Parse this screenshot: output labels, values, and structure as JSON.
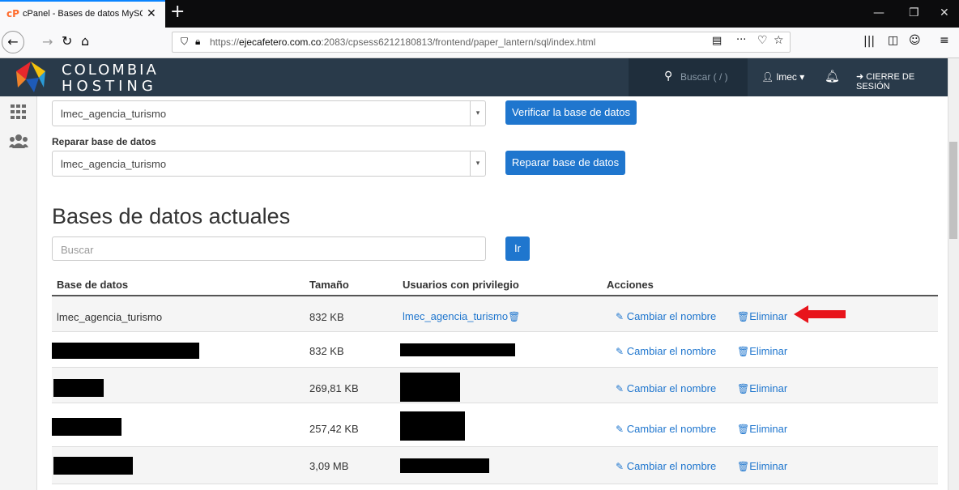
{
  "browser": {
    "tab_title": "cPanel - Bases de datos MySQL",
    "url_prefix": "https://",
    "url_host": "ejecafetero.com.co",
    "url_path": ":2083/cpsess6212180813/frontend/paper_lantern/sql/index.html"
  },
  "header": {
    "logo_line1": "COLOMBIA",
    "logo_line2": "HOSTING",
    "search_placeholder": "Buscar ( / )",
    "user_name": "lmec",
    "logout_label": "CIERRE DE SESIÓN",
    "bg_color": "#293a4a"
  },
  "check_section": {
    "selected_db": "lmec_agencia_turismo",
    "button_label": "Verificar la base de datos"
  },
  "repair_section": {
    "label": "Reparar base de datos",
    "selected_db": "lmec_agencia_turismo",
    "button_label": "Reparar base de datos"
  },
  "current_dbs": {
    "heading": "Bases de datos actuales",
    "search_placeholder": "Buscar",
    "go_button": "Ir",
    "columns": [
      "Base de datos",
      "Tamaño",
      "Usuarios con privilegio",
      "Acciones"
    ],
    "rename_label": "Cambiar el nombre",
    "delete_label": "Eliminar",
    "rows": [
      {
        "db": "lmec_agencia_turismo",
        "size": "832 KB",
        "user": "lmec_agencia_turismo"
      },
      {
        "db": "",
        "size": "832 KB",
        "user": ""
      },
      {
        "db": "",
        "size": "269,81 KB",
        "user": ""
      },
      {
        "db": "",
        "size": "257,42 KB",
        "user": ""
      },
      {
        "db": "",
        "size": "3,09 MB",
        "user": ""
      }
    ]
  },
  "colors": {
    "accent": "#1f76ce",
    "arrow": "#e8141b"
  }
}
